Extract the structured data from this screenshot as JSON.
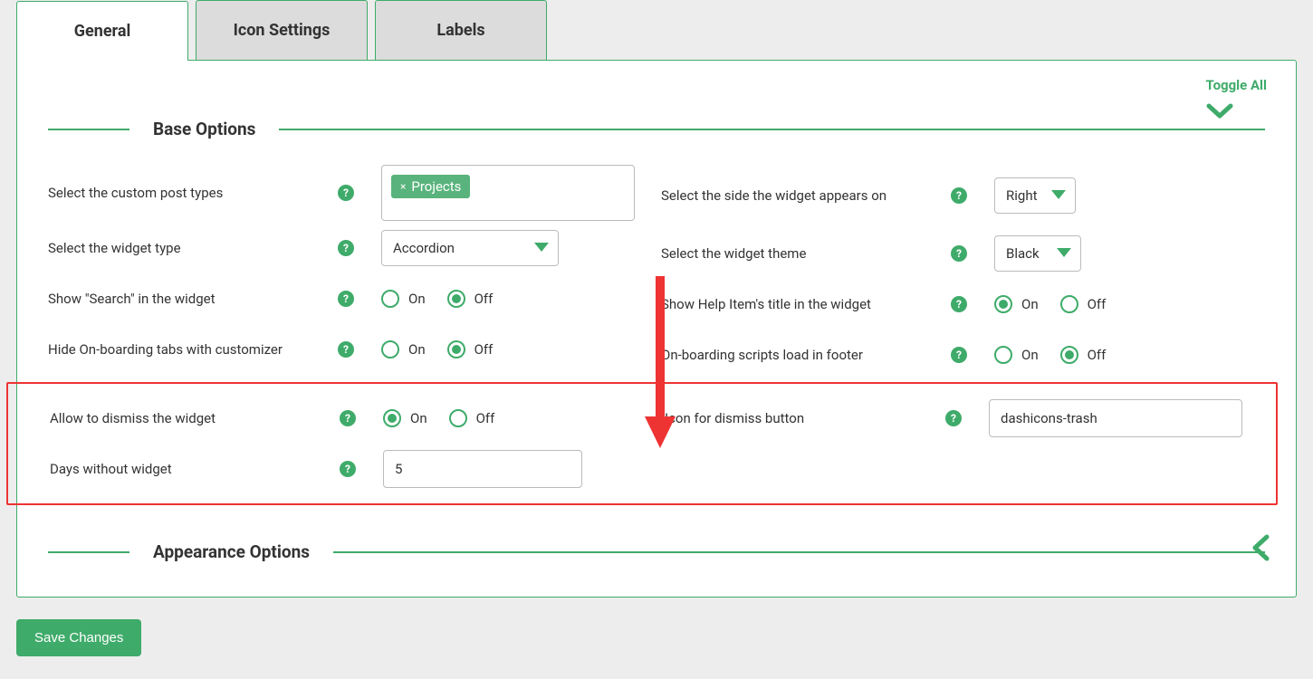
{
  "tabs": {
    "general": "General",
    "icon_settings": "Icon Settings",
    "labels": "Labels"
  },
  "toggle_all": "Toggle All",
  "sections": {
    "base": {
      "title": "Base Options"
    },
    "appearance": {
      "title": "Appearance Options"
    }
  },
  "help_glyph": "?",
  "radio_labels": {
    "on": "On",
    "off": "Off"
  },
  "base": {
    "left": {
      "post_types": {
        "label": "Select the custom post types",
        "tag_value": "Projects",
        "tag_x": "×"
      },
      "widget_type": {
        "label": "Select the widget type",
        "value": "Accordion"
      },
      "show_search": {
        "label": "Show \"Search\" in the widget",
        "selected": "off"
      },
      "hide_onboarding": {
        "label": "Hide On-boarding tabs with customizer",
        "selected": "off"
      },
      "allow_dismiss": {
        "label": "Allow to dismiss the widget",
        "selected": "on"
      },
      "days_without": {
        "label": "Days without widget",
        "value": "5"
      }
    },
    "right": {
      "widget_side": {
        "label": "Select the side the widget appears on",
        "value": "Right"
      },
      "widget_theme": {
        "label": "Select the widget theme",
        "value": "Black"
      },
      "show_title": {
        "label": "Show Help Item's title in the widget",
        "selected": "on"
      },
      "scripts_footer": {
        "label": "On-boarding scripts load in footer",
        "selected": "off"
      },
      "dismiss_icon": {
        "label": "Icon for dismiss button",
        "value": "dashicons-trash"
      }
    }
  },
  "save": "Save Changes"
}
